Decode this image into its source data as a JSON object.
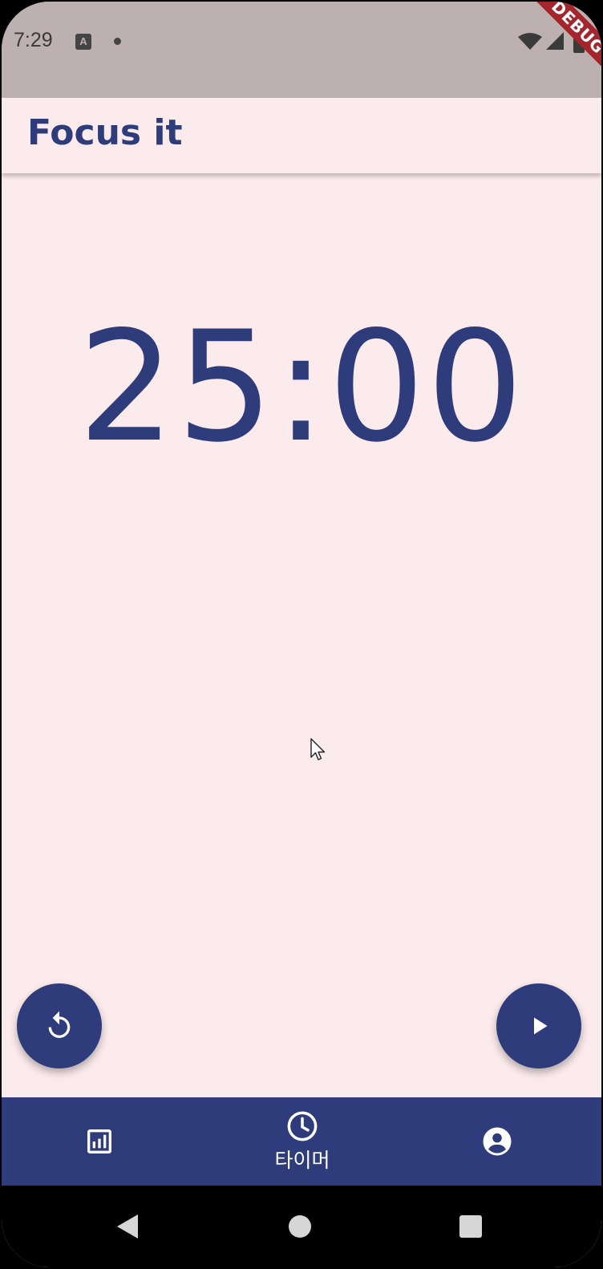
{
  "status_bar": {
    "time": "7:29",
    "debug_banner": "DEBUG",
    "icons": [
      "keyboard-a-icon",
      "notification-dot-icon",
      "wifi-icon",
      "signal-icon",
      "battery-icon"
    ]
  },
  "app_bar": {
    "title": "Focus it"
  },
  "timer": {
    "display": "25:00"
  },
  "fabs": {
    "reset_icon": "restart-icon",
    "play_icon": "play-icon"
  },
  "bottom_nav": {
    "items": [
      {
        "icon": "bar-chart-icon",
        "label": ""
      },
      {
        "icon": "clock-icon",
        "label": "타이머"
      },
      {
        "icon": "account-circle-icon",
        "label": ""
      }
    ],
    "selected_index": 1
  },
  "colors": {
    "primary": "#2f3c7c",
    "background": "#fcebed",
    "status_bar": "#bcb0b1",
    "debug_ribbon": "#a3262c"
  }
}
